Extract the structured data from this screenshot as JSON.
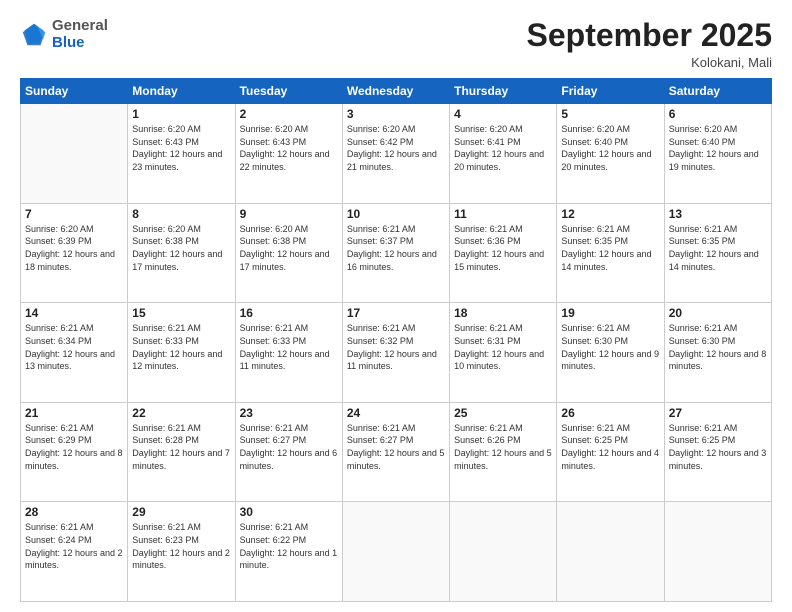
{
  "header": {
    "logo_general": "General",
    "logo_blue": "Blue",
    "month_title": "September 2025",
    "location": "Kolokani, Mali"
  },
  "days_of_week": [
    "Sunday",
    "Monday",
    "Tuesday",
    "Wednesday",
    "Thursday",
    "Friday",
    "Saturday"
  ],
  "weeks": [
    [
      {
        "num": "",
        "sunrise": "",
        "sunset": "",
        "daylight": ""
      },
      {
        "num": "1",
        "sunrise": "Sunrise: 6:20 AM",
        "sunset": "Sunset: 6:43 PM",
        "daylight": "Daylight: 12 hours and 23 minutes."
      },
      {
        "num": "2",
        "sunrise": "Sunrise: 6:20 AM",
        "sunset": "Sunset: 6:43 PM",
        "daylight": "Daylight: 12 hours and 22 minutes."
      },
      {
        "num": "3",
        "sunrise": "Sunrise: 6:20 AM",
        "sunset": "Sunset: 6:42 PM",
        "daylight": "Daylight: 12 hours and 21 minutes."
      },
      {
        "num": "4",
        "sunrise": "Sunrise: 6:20 AM",
        "sunset": "Sunset: 6:41 PM",
        "daylight": "Daylight: 12 hours and 20 minutes."
      },
      {
        "num": "5",
        "sunrise": "Sunrise: 6:20 AM",
        "sunset": "Sunset: 6:40 PM",
        "daylight": "Daylight: 12 hours and 20 minutes."
      },
      {
        "num": "6",
        "sunrise": "Sunrise: 6:20 AM",
        "sunset": "Sunset: 6:40 PM",
        "daylight": "Daylight: 12 hours and 19 minutes."
      }
    ],
    [
      {
        "num": "7",
        "sunrise": "Sunrise: 6:20 AM",
        "sunset": "Sunset: 6:39 PM",
        "daylight": "Daylight: 12 hours and 18 minutes."
      },
      {
        "num": "8",
        "sunrise": "Sunrise: 6:20 AM",
        "sunset": "Sunset: 6:38 PM",
        "daylight": "Daylight: 12 hours and 17 minutes."
      },
      {
        "num": "9",
        "sunrise": "Sunrise: 6:20 AM",
        "sunset": "Sunset: 6:38 PM",
        "daylight": "Daylight: 12 hours and 17 minutes."
      },
      {
        "num": "10",
        "sunrise": "Sunrise: 6:21 AM",
        "sunset": "Sunset: 6:37 PM",
        "daylight": "Daylight: 12 hours and 16 minutes."
      },
      {
        "num": "11",
        "sunrise": "Sunrise: 6:21 AM",
        "sunset": "Sunset: 6:36 PM",
        "daylight": "Daylight: 12 hours and 15 minutes."
      },
      {
        "num": "12",
        "sunrise": "Sunrise: 6:21 AM",
        "sunset": "Sunset: 6:35 PM",
        "daylight": "Daylight: 12 hours and 14 minutes."
      },
      {
        "num": "13",
        "sunrise": "Sunrise: 6:21 AM",
        "sunset": "Sunset: 6:35 PM",
        "daylight": "Daylight: 12 hours and 14 minutes."
      }
    ],
    [
      {
        "num": "14",
        "sunrise": "Sunrise: 6:21 AM",
        "sunset": "Sunset: 6:34 PM",
        "daylight": "Daylight: 12 hours and 13 minutes."
      },
      {
        "num": "15",
        "sunrise": "Sunrise: 6:21 AM",
        "sunset": "Sunset: 6:33 PM",
        "daylight": "Daylight: 12 hours and 12 minutes."
      },
      {
        "num": "16",
        "sunrise": "Sunrise: 6:21 AM",
        "sunset": "Sunset: 6:33 PM",
        "daylight": "Daylight: 12 hours and 11 minutes."
      },
      {
        "num": "17",
        "sunrise": "Sunrise: 6:21 AM",
        "sunset": "Sunset: 6:32 PM",
        "daylight": "Daylight: 12 hours and 11 minutes."
      },
      {
        "num": "18",
        "sunrise": "Sunrise: 6:21 AM",
        "sunset": "Sunset: 6:31 PM",
        "daylight": "Daylight: 12 hours and 10 minutes."
      },
      {
        "num": "19",
        "sunrise": "Sunrise: 6:21 AM",
        "sunset": "Sunset: 6:30 PM",
        "daylight": "Daylight: 12 hours and 9 minutes."
      },
      {
        "num": "20",
        "sunrise": "Sunrise: 6:21 AM",
        "sunset": "Sunset: 6:30 PM",
        "daylight": "Daylight: 12 hours and 8 minutes."
      }
    ],
    [
      {
        "num": "21",
        "sunrise": "Sunrise: 6:21 AM",
        "sunset": "Sunset: 6:29 PM",
        "daylight": "Daylight: 12 hours and 8 minutes."
      },
      {
        "num": "22",
        "sunrise": "Sunrise: 6:21 AM",
        "sunset": "Sunset: 6:28 PM",
        "daylight": "Daylight: 12 hours and 7 minutes."
      },
      {
        "num": "23",
        "sunrise": "Sunrise: 6:21 AM",
        "sunset": "Sunset: 6:27 PM",
        "daylight": "Daylight: 12 hours and 6 minutes."
      },
      {
        "num": "24",
        "sunrise": "Sunrise: 6:21 AM",
        "sunset": "Sunset: 6:27 PM",
        "daylight": "Daylight: 12 hours and 5 minutes."
      },
      {
        "num": "25",
        "sunrise": "Sunrise: 6:21 AM",
        "sunset": "Sunset: 6:26 PM",
        "daylight": "Daylight: 12 hours and 5 minutes."
      },
      {
        "num": "26",
        "sunrise": "Sunrise: 6:21 AM",
        "sunset": "Sunset: 6:25 PM",
        "daylight": "Daylight: 12 hours and 4 minutes."
      },
      {
        "num": "27",
        "sunrise": "Sunrise: 6:21 AM",
        "sunset": "Sunset: 6:25 PM",
        "daylight": "Daylight: 12 hours and 3 minutes."
      }
    ],
    [
      {
        "num": "28",
        "sunrise": "Sunrise: 6:21 AM",
        "sunset": "Sunset: 6:24 PM",
        "daylight": "Daylight: 12 hours and 2 minutes."
      },
      {
        "num": "29",
        "sunrise": "Sunrise: 6:21 AM",
        "sunset": "Sunset: 6:23 PM",
        "daylight": "Daylight: 12 hours and 2 minutes."
      },
      {
        "num": "30",
        "sunrise": "Sunrise: 6:21 AM",
        "sunset": "Sunset: 6:22 PM",
        "daylight": "Daylight: 12 hours and 1 minute."
      },
      {
        "num": "",
        "sunrise": "",
        "sunset": "",
        "daylight": ""
      },
      {
        "num": "",
        "sunrise": "",
        "sunset": "",
        "daylight": ""
      },
      {
        "num": "",
        "sunrise": "",
        "sunset": "",
        "daylight": ""
      },
      {
        "num": "",
        "sunrise": "",
        "sunset": "",
        "daylight": ""
      }
    ]
  ]
}
